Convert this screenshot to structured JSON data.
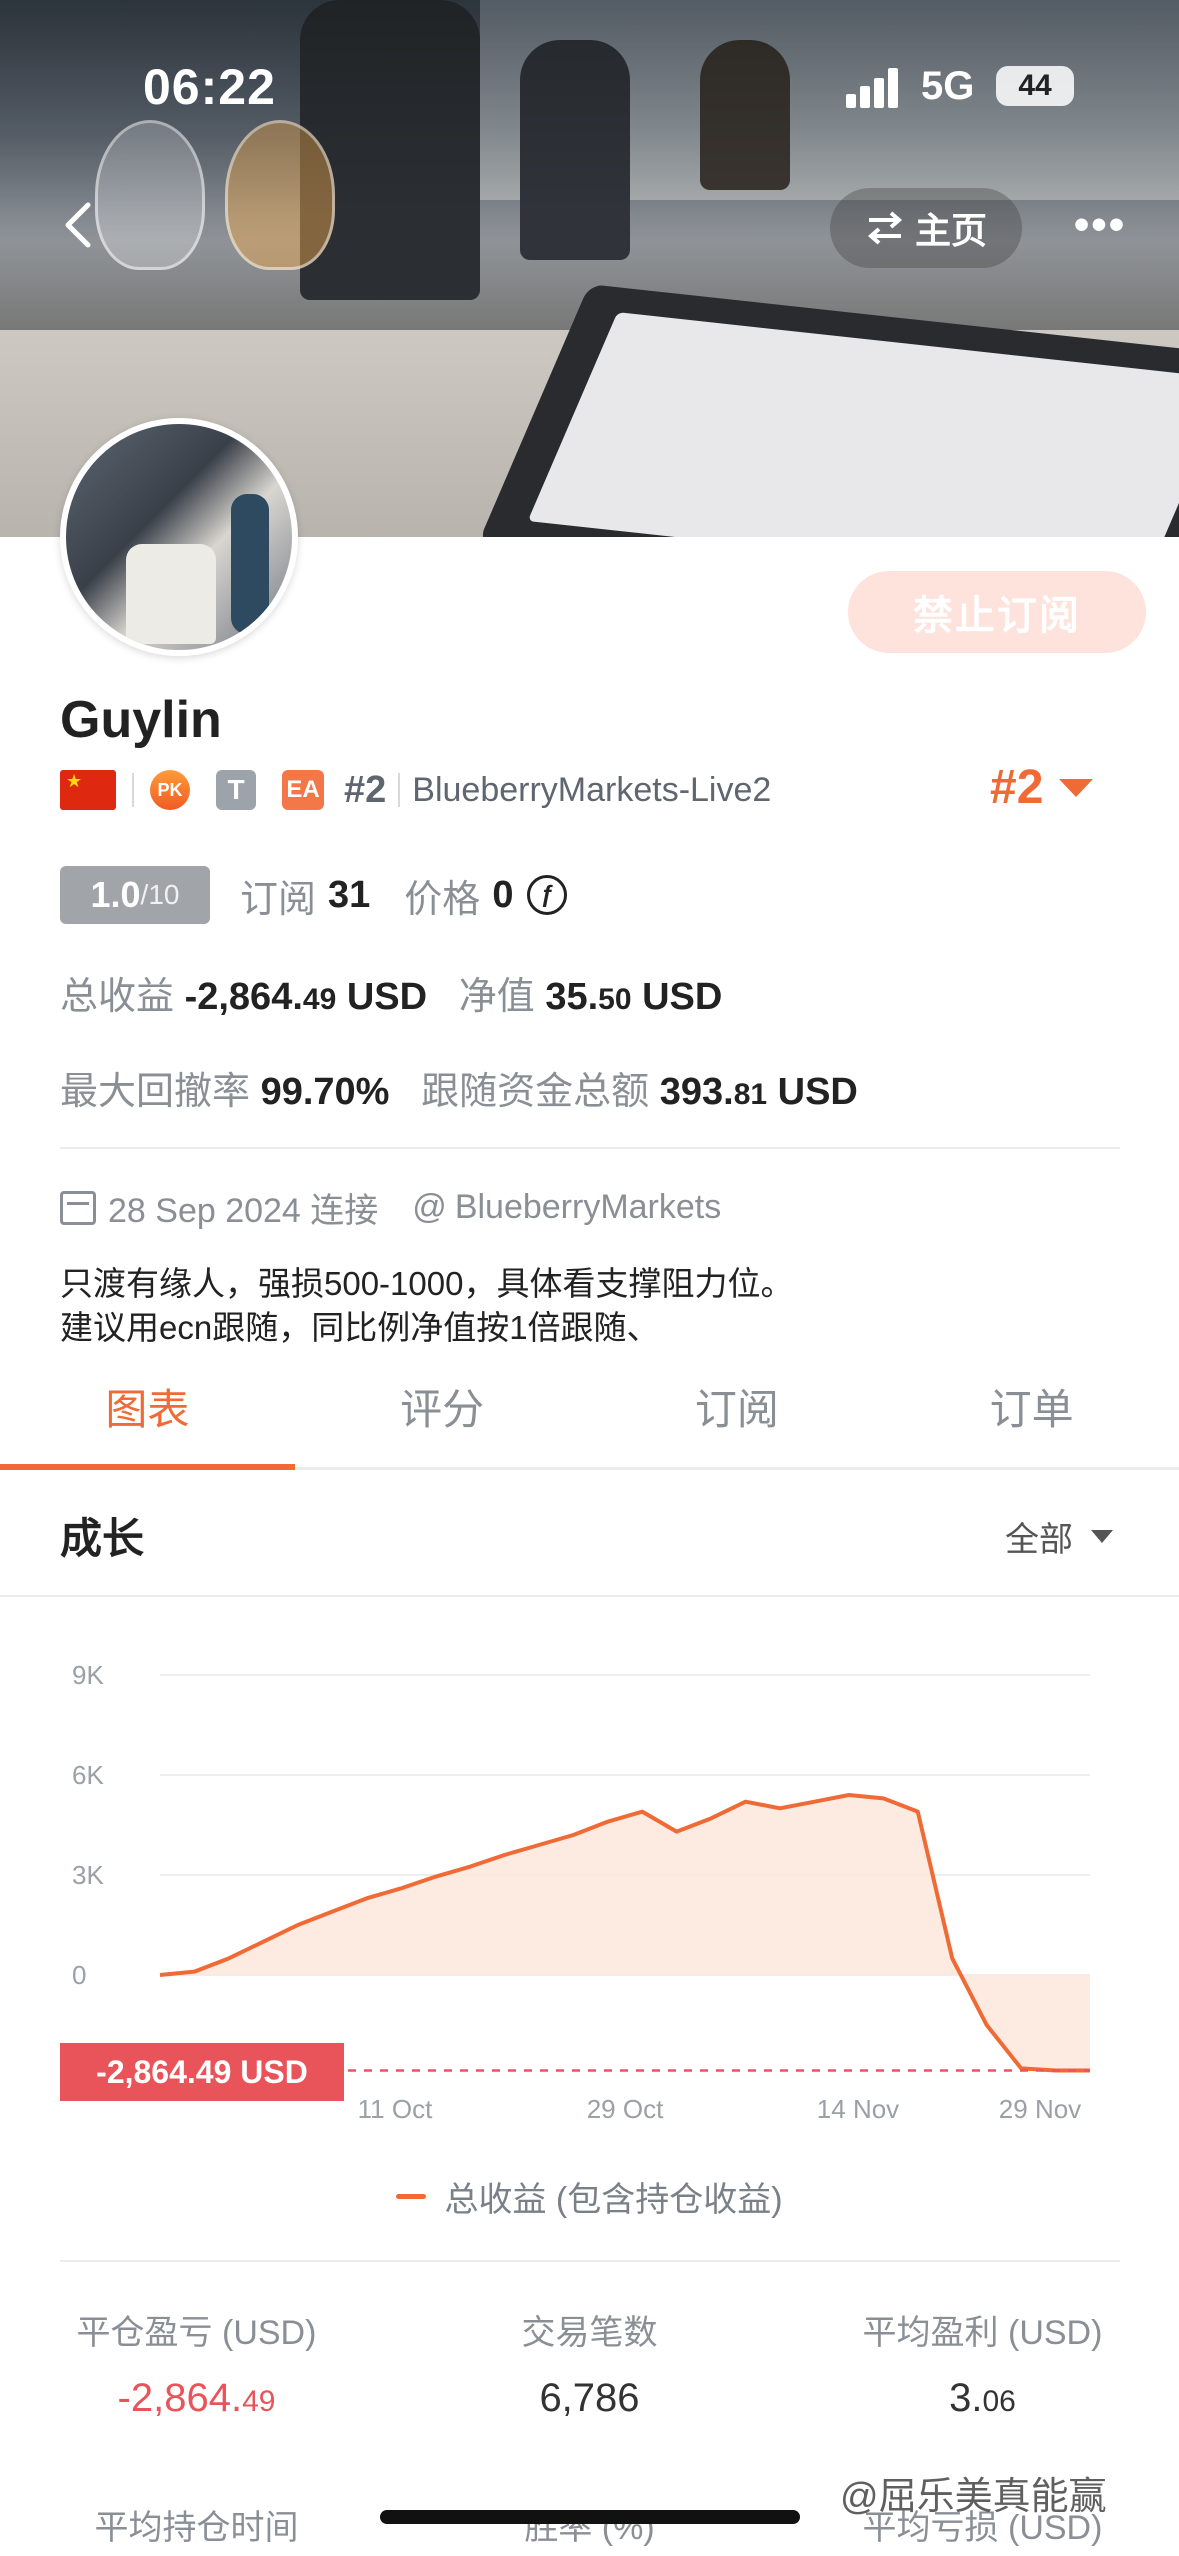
{
  "status": {
    "time": "06:22",
    "network": "5G",
    "battery": "44"
  },
  "nav": {
    "home_label": "主页",
    "more_label": "•••"
  },
  "profile": {
    "subscribe_label": "禁止订阅",
    "name": "Guylin",
    "rank_small": "#2",
    "broker": "BlueberryMarkets-Live2",
    "rank_big": "#2",
    "badge_t": "T",
    "badge_ea": "EA",
    "badge_pk": "PK",
    "score": "1.0",
    "score_max": "/10",
    "subscribe_count_label": "订阅",
    "subscribe_count": "31",
    "price_label": "价格",
    "price": "0",
    "total_profit_label": "总收益",
    "total_profit_main": "-2,864.",
    "total_profit_dec": "49",
    "total_profit_unit": "USD",
    "equity_label": "净值",
    "equity_main": "35.",
    "equity_dec": "50",
    "equity_unit": "USD",
    "max_drawdown_label": "最大回撤率",
    "max_drawdown": "99.70%",
    "follow_funds_label": "跟随资金总额",
    "follow_funds_main": "393.",
    "follow_funds_dec": "81",
    "follow_funds_unit": "USD",
    "connected_date": "28 Sep 2024 连接",
    "broker_at": "@",
    "broker_name": "BlueberryMarkets",
    "desc_line1": "只渡有缘人，强损500-1000，具体看支撑阻力位。",
    "desc_line2": "建议用ecn跟随，同比例净值按1倍跟随、"
  },
  "tabs": [
    {
      "label": "图表",
      "active": true
    },
    {
      "label": "评分",
      "active": false
    },
    {
      "label": "订阅",
      "active": false
    },
    {
      "label": "订单",
      "active": false
    }
  ],
  "growth": {
    "title": "成长",
    "range_label": "全部"
  },
  "chart_data": {
    "type": "area",
    "title": "",
    "y_ticks": [
      "9K",
      "6K",
      "3K",
      "0"
    ],
    "ylim": [
      -3000,
      9500
    ],
    "x_ticks": [
      "11 Oct",
      "29 Oct",
      "14 Nov",
      "29 Nov"
    ],
    "current_value_label": "-2,864.49 USD",
    "current_value": -2864.49,
    "series": [
      {
        "name": "总收益 (包含持仓收益)",
        "x": [
          "28 Sep",
          "01 Oct",
          "04 Oct",
          "07 Oct",
          "10 Oct",
          "13 Oct",
          "16 Oct",
          "19 Oct",
          "22 Oct",
          "25 Oct",
          "28 Oct",
          "31 Oct",
          "03 Nov",
          "06 Nov",
          "08 Nov",
          "10 Nov",
          "12 Nov",
          "14 Nov",
          "16 Nov",
          "18 Nov",
          "20 Nov",
          "22 Nov",
          "23 Nov",
          "24 Nov",
          "25 Nov",
          "27 Nov",
          "29 Nov",
          "01 Dec"
        ],
        "values": [
          0,
          100,
          500,
          1000,
          1500,
          1900,
          2300,
          2600,
          2950,
          3250,
          3600,
          3900,
          4200,
          4600,
          4900,
          4300,
          4700,
          5200,
          5000,
          5200,
          5400,
          5300,
          4900,
          500,
          -1500,
          -2800,
          -2864,
          -2864
        ]
      }
    ],
    "colors": {
      "line": "#f06a35",
      "fill": "#fde6dc",
      "baseline": "#e9545a"
    }
  },
  "metrics": [
    {
      "label": "平仓盈亏 (USD)",
      "main": "-2,864.",
      "dec": "49",
      "negative": true
    },
    {
      "label": "交易笔数",
      "main": "6,786",
      "dec": "",
      "negative": false
    },
    {
      "label": "平均盈利 (USD)",
      "main": "3.",
      "dec": "06",
      "negative": false
    }
  ],
  "metrics2": [
    {
      "label": "平均持仓时间"
    },
    {
      "label": "胜率 (%)"
    },
    {
      "label": "平均亏损 (USD)"
    }
  ],
  "watermark": "@屈乐美真能赢"
}
